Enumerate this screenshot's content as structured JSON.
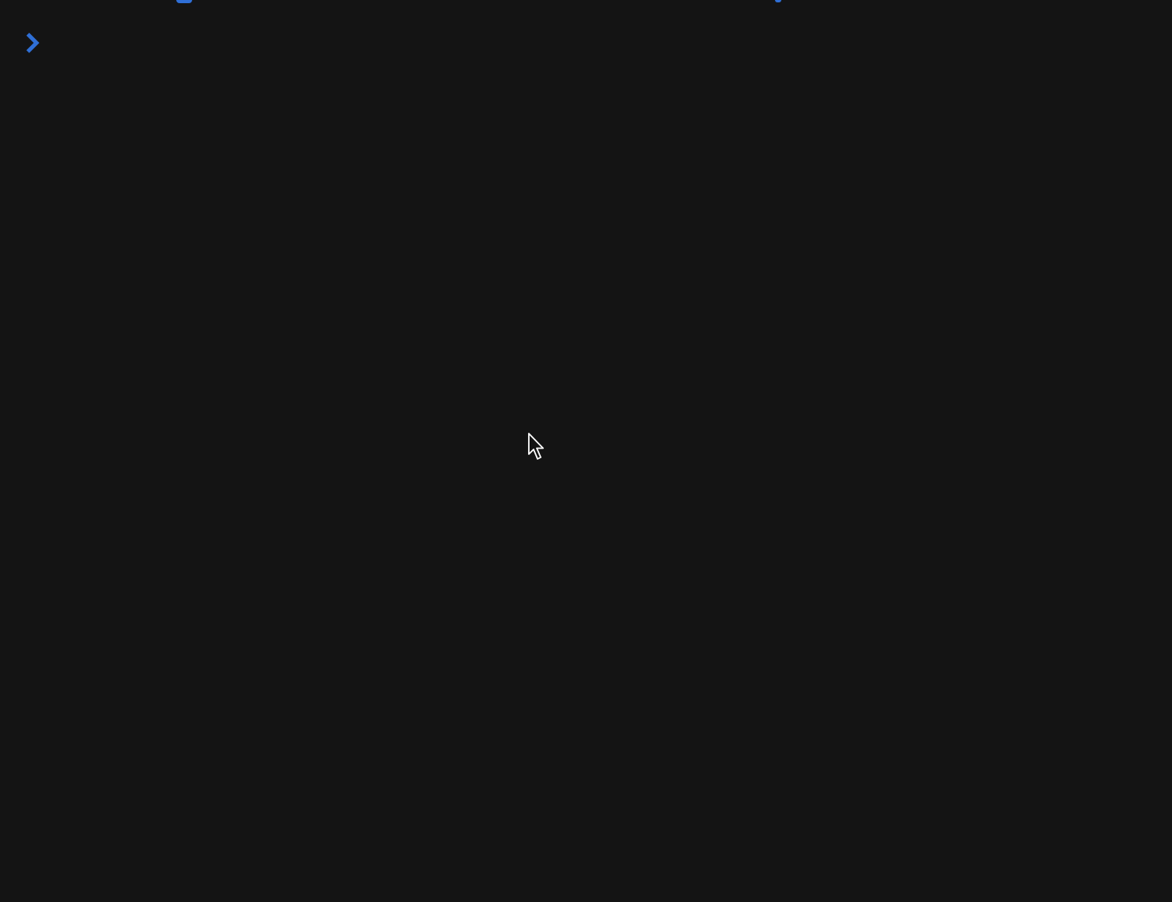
{
  "terminal": {
    "background_color": "#141414",
    "accent_color": "#2f6fd6",
    "prompt_icon": "chevron-right-icon",
    "input_text": ""
  },
  "pointer": {
    "icon": "mouse-pointer-icon"
  }
}
